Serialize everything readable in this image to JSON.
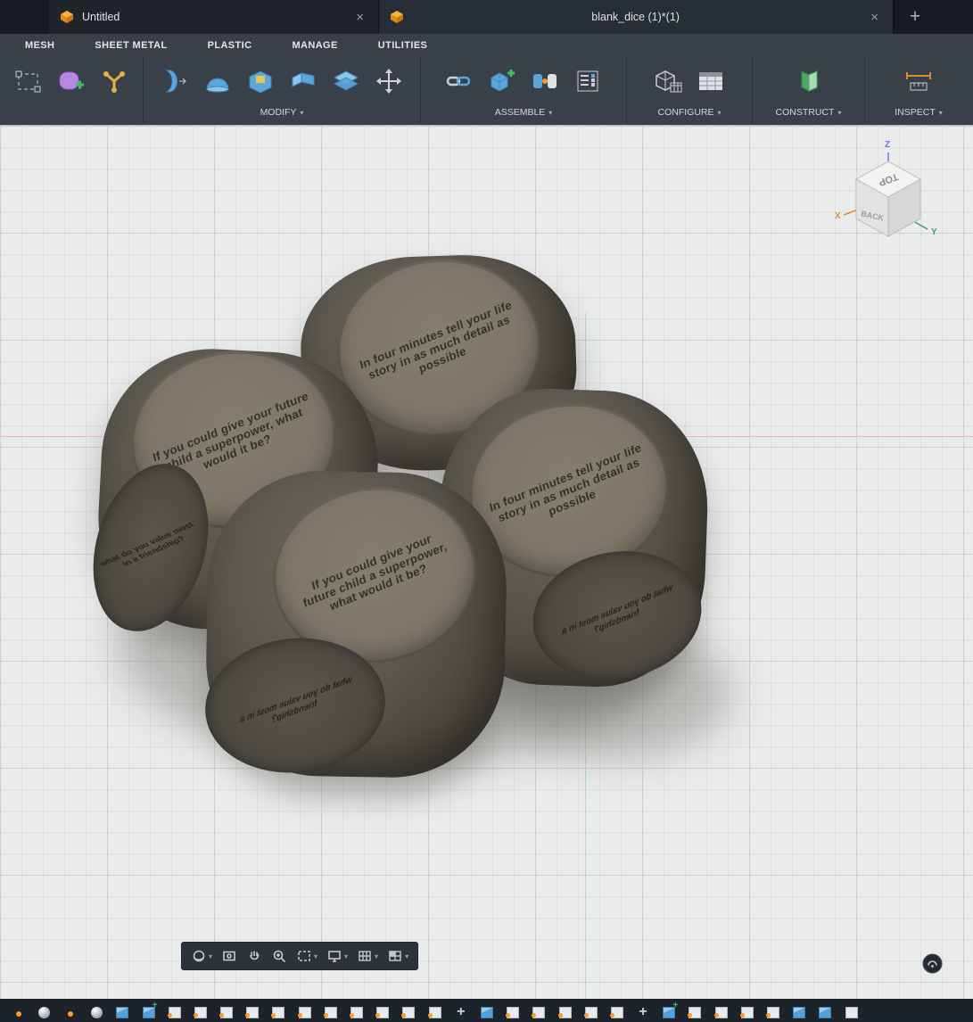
{
  "ui": {
    "caret": "▾",
    "close_glyph": "×",
    "add_glyph": "+"
  },
  "tab_bar": {
    "tabs": [
      {
        "title": "Untitled",
        "active": false
      },
      {
        "title": "blank_dice (1)*(1)",
        "active": true
      }
    ]
  },
  "ribbon": {
    "tabs": [
      {
        "label": "MESH"
      },
      {
        "label": "SHEET METAL"
      },
      {
        "label": "PLASTIC"
      },
      {
        "label": "MANAGE"
      },
      {
        "label": "UTILITIES"
      }
    ],
    "groups": [
      {
        "label": "MODIFY"
      },
      {
        "label": "ASSEMBLE"
      },
      {
        "label": "CONFIGURE"
      },
      {
        "label": "CONSTRUCT"
      },
      {
        "label": "INSPECT"
      }
    ],
    "toolbar_icons": [
      "box-select",
      "create-form",
      "convergence",
      "thicken",
      "dome",
      "extrude-hole",
      "fold",
      "split-body",
      "move",
      "insert-link",
      "new-component",
      "joint",
      "bom-list",
      "configure-component",
      "configuration-table",
      "construct-plane",
      "measure"
    ]
  },
  "viewcube": {
    "top": "TOP",
    "back": "BACK",
    "x": "X",
    "y": "Y",
    "z": "Z"
  },
  "viewport": {
    "dice": [
      {
        "id": "top",
        "top_text": "In four minutes tell your life story in as much detail as possible"
      },
      {
        "id": "left",
        "top_text": "If you could give your future child a superpower, what would it be?",
        "side_text": "what do you value most in a friendship?"
      },
      {
        "id": "front",
        "top_text": "If you could give your future child a superpower, what would it be?",
        "side_text": "what do you value most in a friendship?"
      },
      {
        "id": "right",
        "top_text": "In four minutes tell your life story in as much detail as possible",
        "side_text": "what do you value most in a friendship?"
      }
    ]
  },
  "navbar_icons": [
    "orbit",
    "look-at",
    "pan",
    "zoom",
    "window-zoom",
    "display-settings",
    "grid",
    "viewports"
  ],
  "timeline": {
    "features": [
      {
        "type": "dot"
      },
      {
        "type": "sphere"
      },
      {
        "type": "dot"
      },
      {
        "type": "sphere"
      },
      {
        "type": "cube"
      },
      {
        "type": "cubeplus"
      },
      {
        "type": "sketch"
      },
      {
        "type": "sketch"
      },
      {
        "type": "sketch"
      },
      {
        "type": "sketch"
      },
      {
        "type": "sketch"
      },
      {
        "type": "sketch"
      },
      {
        "type": "sketch"
      },
      {
        "type": "sketch"
      },
      {
        "type": "sketch"
      },
      {
        "type": "sketch"
      },
      {
        "type": "sketch"
      },
      {
        "type": "move"
      },
      {
        "type": "cube"
      },
      {
        "type": "sketch"
      },
      {
        "type": "sketch"
      },
      {
        "type": "sketch"
      },
      {
        "type": "sketch"
      },
      {
        "type": "sketch"
      },
      {
        "type": "move"
      },
      {
        "type": "cubeplus"
      },
      {
        "type": "sketch"
      },
      {
        "type": "sketch"
      },
      {
        "type": "sketch"
      },
      {
        "type": "sketch"
      },
      {
        "type": "cube"
      },
      {
        "type": "cube"
      },
      {
        "type": "grid"
      }
    ]
  },
  "colors": {
    "accent_orange": "#f59e2c",
    "tool_blue": "#5ba6da",
    "ribbon_bg": "#3a4049",
    "viewport_bg": "#eaebeb",
    "die_body": "#56524a",
    "die_face": "#7e786c"
  }
}
